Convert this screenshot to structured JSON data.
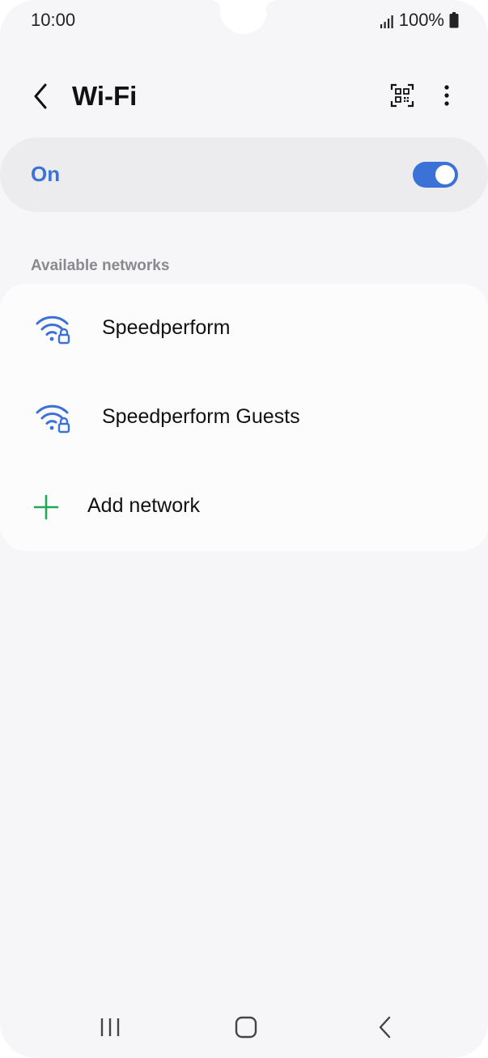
{
  "status_bar": {
    "time": "10:00",
    "battery": "100%",
    "icons": [
      "signal-icon",
      "battery-icon"
    ]
  },
  "app_bar": {
    "title": "Wi-Fi",
    "icons": [
      "back-arrow-icon",
      "qr-code-icon",
      "more-vertical-icon"
    ]
  },
  "master_switch": {
    "label": "On",
    "state": "on",
    "accent_color": "#3b72d8"
  },
  "networks_section": {
    "header": "Available networks",
    "networks": [
      {
        "name": "Speedperform",
        "icon": "wifi-locked-icon"
      },
      {
        "name": "Speedperform Guests",
        "icon": "wifi-locked-icon"
      }
    ],
    "add_network": {
      "label": "Add network",
      "icon": "plus-icon",
      "icon_color": "#1fa856"
    }
  },
  "nav_bar": {
    "icons": [
      "recents-icon",
      "home-icon",
      "back-icon"
    ]
  }
}
